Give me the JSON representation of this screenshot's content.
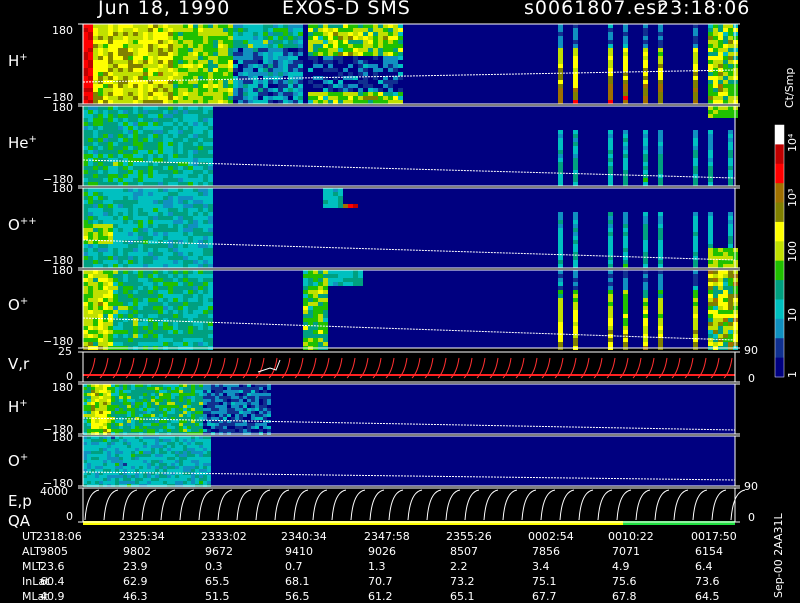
{
  "header": {
    "date": "Jun 18, 1990",
    "instrument": "EXOS-D SMS",
    "file": "s0061807.esr",
    "time": "23:18:06"
  },
  "panels": [
    {
      "label": "H",
      "sup": "+",
      "top": "180",
      "bottom": "−180"
    },
    {
      "label": "He",
      "sup": "+",
      "top": "180",
      "bottom": "−180"
    },
    {
      "label": "O",
      "sup": "++",
      "top": "180",
      "bottom": "−180"
    },
    {
      "label": "O",
      "sup": "+",
      "top": "180",
      "bottom": "−180"
    },
    {
      "label": "V,r",
      "sup": "",
      "top": "25",
      "bottom": "0",
      "rtop": "90",
      "rbottom": "0"
    },
    {
      "label": "H",
      "sup": "+",
      "top": "180",
      "bottom": "−180"
    },
    {
      "label": "O",
      "sup": "+",
      "top": "180",
      "bottom": "−180"
    },
    {
      "label": "E,p",
      "sup": "",
      "label2": "QA",
      "top": "4000",
      "bottom": "0",
      "rtop": "90",
      "rbottom": "0"
    }
  ],
  "colorbar": {
    "unit": "Ct/Smp",
    "ticks": [
      "10⁴",
      "10³",
      "100",
      "10",
      "1"
    ],
    "colors": [
      "#ffffff",
      "#c00000",
      "#ff0000",
      "#a07000",
      "#808000",
      "#ffff00",
      "#c0e000",
      "#20c000",
      "#00a080",
      "#00c0c0",
      "#1090c0",
      "#103090",
      "#000080"
    ]
  },
  "table": {
    "rows": [
      {
        "label": "UT",
        "values": [
          "2318:06",
          "2325:34",
          "2333:02",
          "2340:34",
          "2347:58",
          "2355:26",
          "0002:54",
          "0010:22",
          "0017:50"
        ]
      },
      {
        "label": "ALT",
        "values": [
          "9805",
          "9802",
          "9672",
          "9410",
          "9026",
          "8507",
          "7856",
          "7071",
          "6154"
        ]
      },
      {
        "label": "MLT",
        "values": [
          "23.6",
          "23.9",
          "0.3",
          "0.7",
          "1.3",
          "2.2",
          "3.4",
          "4.9",
          "6.4"
        ]
      },
      {
        "label": "InLat",
        "values": [
          "60.4",
          "62.9",
          "65.5",
          "68.1",
          "70.7",
          "73.2",
          "75.1",
          "75.6",
          "73.6"
        ]
      },
      {
        "label": "MLat",
        "values": [
          "40.9",
          "46.3",
          "51.5",
          "56.5",
          "61.2",
          "65.1",
          "67.7",
          "67.8",
          "64.5"
        ]
      }
    ]
  },
  "footer": {
    "note": "Sep-00  2AA31L"
  }
}
